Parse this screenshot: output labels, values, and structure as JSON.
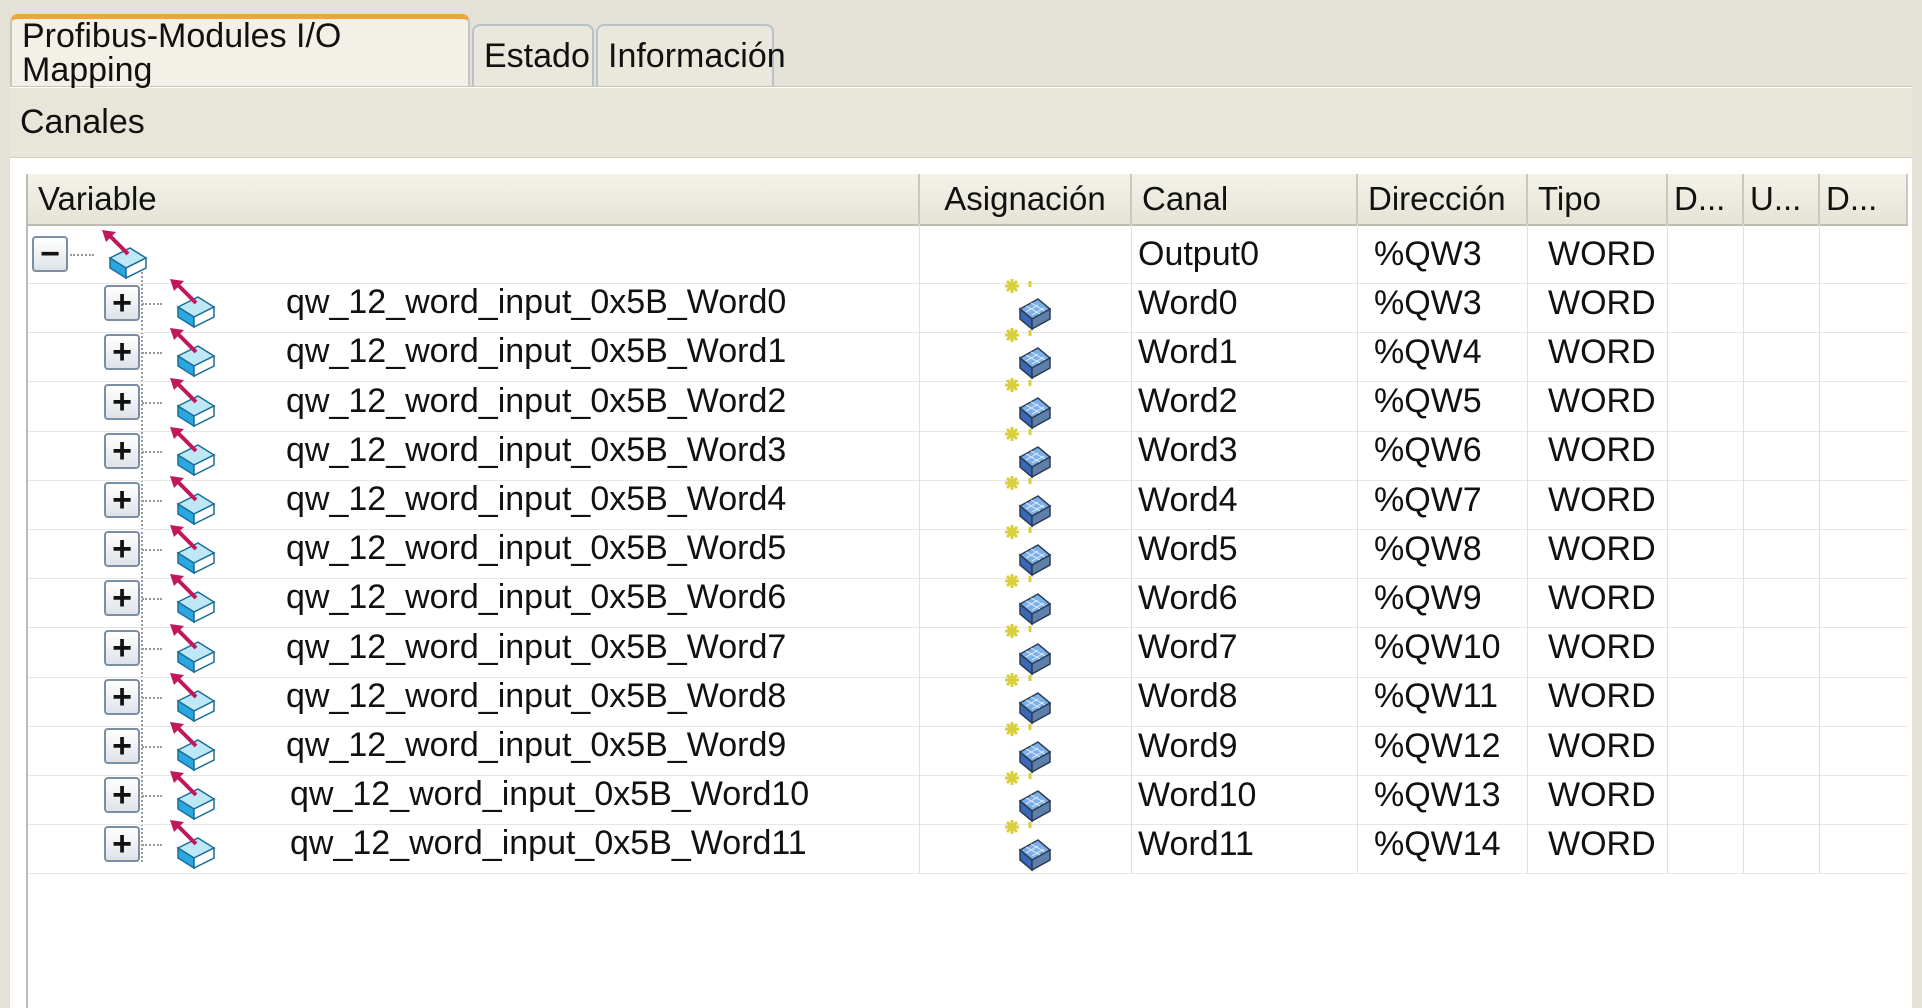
{
  "tabs": [
    {
      "label": "Profibus-Modules I/O Mapping",
      "active": true
    },
    {
      "label": "Estado",
      "active": false
    },
    {
      "label": "Información",
      "active": false
    }
  ],
  "section_title": "Canales",
  "columns": [
    "Variable",
    "Asignación",
    "Canal",
    "Dirección",
    "Tipo",
    "D...",
    "U...",
    "D..."
  ],
  "parent_row": {
    "canal": "Output0",
    "direccion": "%QW3",
    "tipo": "WORD",
    "expander": "−"
  },
  "rows": [
    {
      "variable": "qw_12_word_input_0x5B_Word0",
      "canal": "Word0",
      "direccion": "%QW3",
      "tipo": "WORD"
    },
    {
      "variable": "qw_12_word_input_0x5B_Word1",
      "canal": "Word1",
      "direccion": "%QW4",
      "tipo": "WORD"
    },
    {
      "variable": "qw_12_word_input_0x5B_Word2",
      "canal": "Word2",
      "direccion": "%QW5",
      "tipo": "WORD"
    },
    {
      "variable": "qw_12_word_input_0x5B_Word3",
      "canal": "Word3",
      "direccion": "%QW6",
      "tipo": "WORD"
    },
    {
      "variable": "qw_12_word_input_0x5B_Word4",
      "canal": "Word4",
      "direccion": "%QW7",
      "tipo": "WORD"
    },
    {
      "variable": "qw_12_word_input_0x5B_Word5",
      "canal": "Word5",
      "direccion": "%QW8",
      "tipo": "WORD"
    },
    {
      "variable": "qw_12_word_input_0x5B_Word6",
      "canal": "Word6",
      "direccion": "%QW9",
      "tipo": "WORD"
    },
    {
      "variable": "qw_12_word_input_0x5B_Word7",
      "canal": "Word7",
      "direccion": "%QW10",
      "tipo": "WORD"
    },
    {
      "variable": "qw_12_word_input_0x5B_Word8",
      "canal": "Word8",
      "direccion": "%QW11",
      "tipo": "WORD"
    },
    {
      "variable": "qw_12_word_input_0x5B_Word9",
      "canal": "Word9",
      "direccion": "%QW12",
      "tipo": "WORD"
    },
    {
      "variable": "qw_12_word_input_0x5B_Word10",
      "canal": "Word10",
      "direccion": "%QW13",
      "tipo": "WORD"
    },
    {
      "variable": "qw_12_word_input_0x5B_Word11",
      "canal": "Word11",
      "direccion": "%QW14",
      "tipo": "WORD"
    }
  ],
  "child_expander": "+",
  "icons": {
    "variable": "output-variable-icon",
    "mapping": "map-to-new-variable-icon"
  },
  "colors": {
    "tab_accent": "#f0a43a",
    "chrome": "#e4e2d6",
    "icon_blue": "#2aa6e0",
    "arrow": "#c2185b"
  }
}
